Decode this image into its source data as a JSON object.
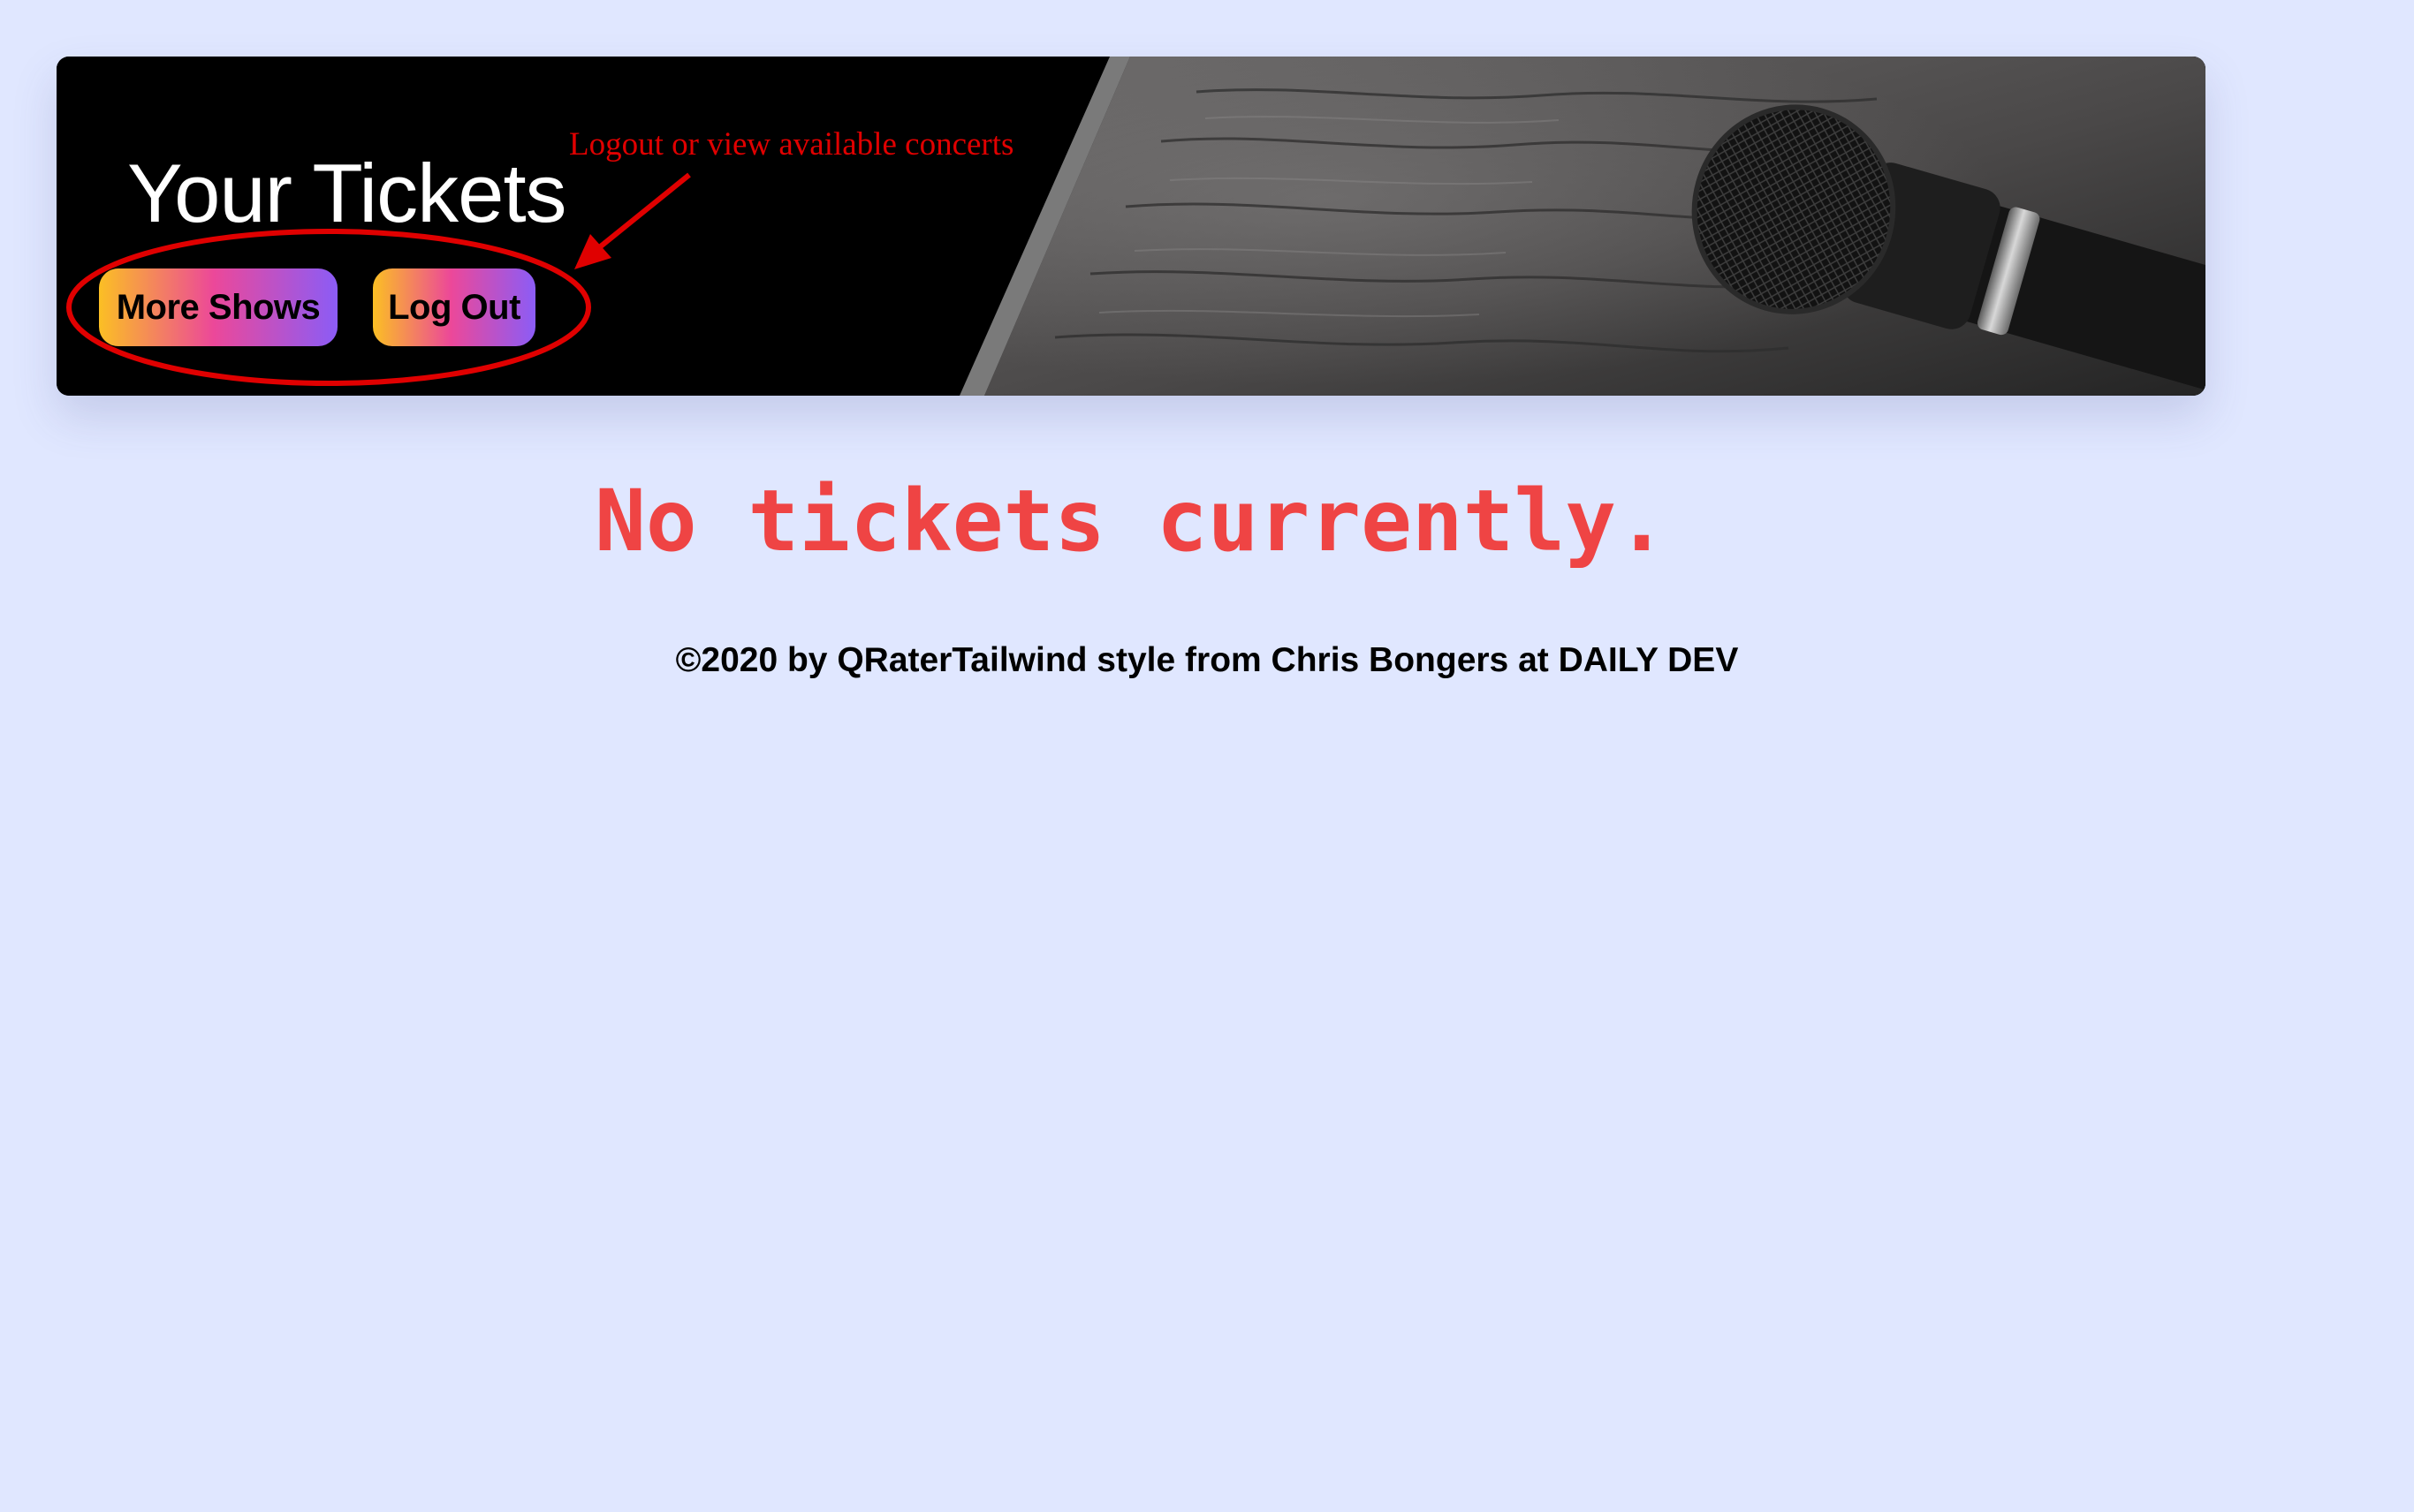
{
  "header": {
    "title": "Your Tickets",
    "buttons": {
      "more_shows": "More Shows",
      "log_out": "Log Out"
    },
    "image": "microphone-on-wooden-table"
  },
  "annotation": {
    "text": "Logout or view available concerts",
    "color": "#e00000"
  },
  "main": {
    "empty_message": "No tickets currently."
  },
  "footer": {
    "text": "©2020 by QRaterTailwind style from Chris Bongers at DAILY DEV"
  },
  "colors": {
    "page_background": "#e0e7ff",
    "empty_message": "#ef4444",
    "button_gradient": [
      "#fbbf24",
      "#ec4899",
      "#8b5cf6"
    ]
  }
}
